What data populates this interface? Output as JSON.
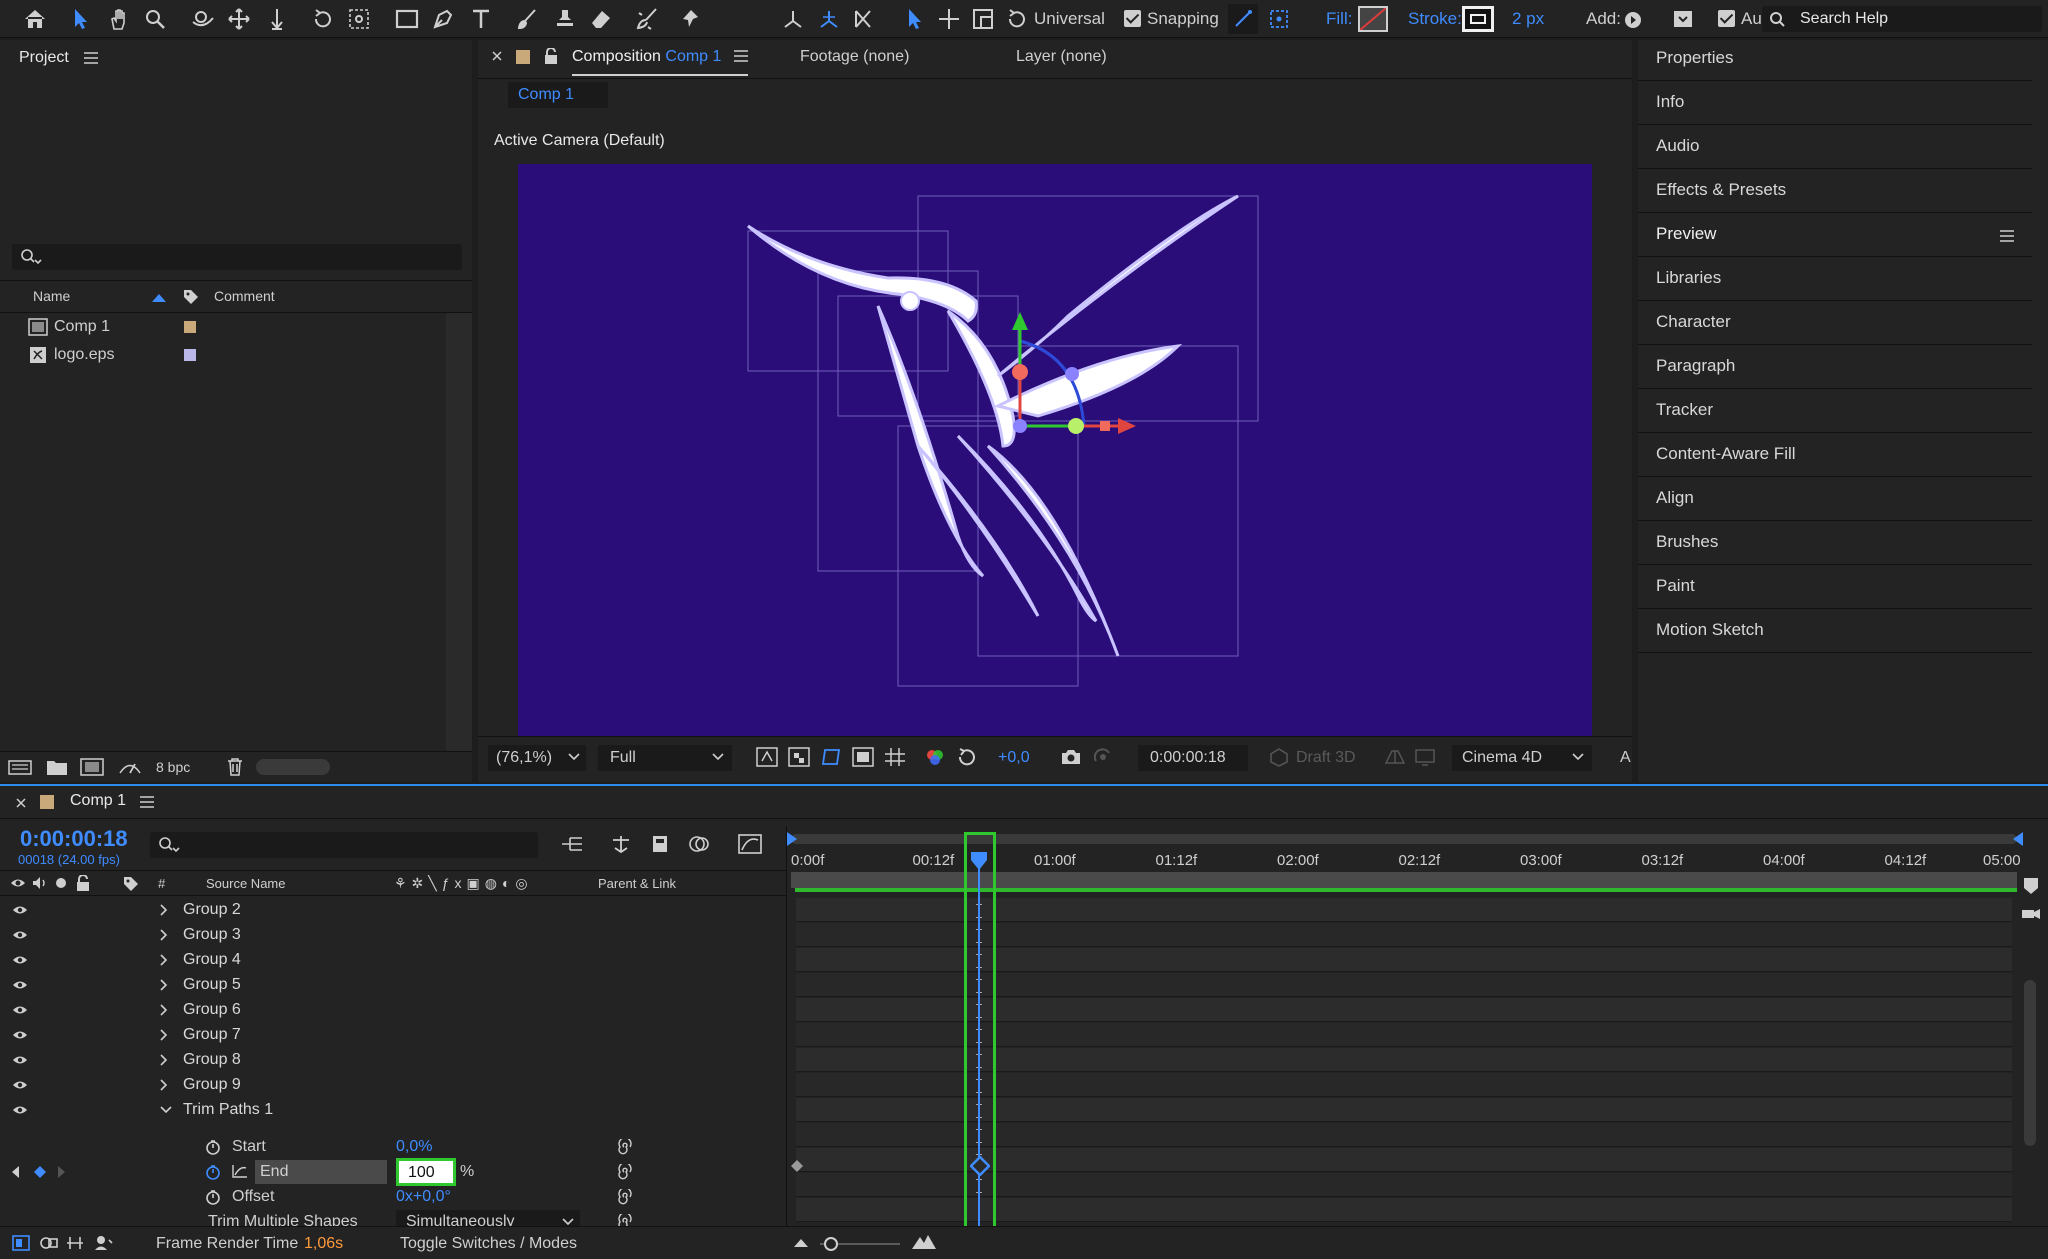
{
  "toolbar": {
    "mode": "Universal",
    "snapping": "Snapping",
    "fill_label": "Fill:",
    "stroke_label": "Stroke:",
    "stroke_width": "2 px",
    "add_label": "Add:",
    "auto_label": "Auto",
    "search_placeholder": "Search Help"
  },
  "project": {
    "title": "Project",
    "col_name": "Name",
    "col_comment": "Comment",
    "items": [
      {
        "name": "Comp 1",
        "color": "#c9a87a"
      },
      {
        "name": "logo.eps",
        "color": "#b9b6e8"
      }
    ],
    "bpc": "8 bpc"
  },
  "comp": {
    "tab_prefix": "Composition",
    "tab_name": "Comp 1",
    "footage": "Footage (none)",
    "layer": "Layer (none)",
    "sub_tab": "Comp 1",
    "camera": "Active Camera (Default)",
    "zoom": "(76,1%)",
    "resolution": "Full",
    "exposure": "+0,0",
    "timecode": "0:00:00:18",
    "draft": "Draft 3D",
    "renderer": "Cinema 4D",
    "extra": "A",
    "bg": "#2a0d78"
  },
  "right_panels": [
    "Properties",
    "Info",
    "Audio",
    "Effects & Presets",
    "Preview",
    "Libraries",
    "Character",
    "Paragraph",
    "Tracker",
    "Content-Aware Fill",
    "Align",
    "Brushes",
    "Paint",
    "Motion Sketch"
  ],
  "timeline": {
    "comp_name": "Comp 1",
    "timecode": "0:00:00:18",
    "frame_info": "00018 (24.00 fps)",
    "col_num": "#",
    "col_source": "Source Name",
    "col_parent": "Parent & Link",
    "groups": [
      "Group 2",
      "Group 3",
      "Group 4",
      "Group 5",
      "Group 6",
      "Group 7",
      "Group 8",
      "Group 9"
    ],
    "trim": "Trim Paths 1",
    "props": {
      "start_label": "Start",
      "start_value": "0,0%",
      "end_label": "End",
      "end_value": "100",
      "end_unit": "%",
      "offset_label": "Offset",
      "offset_value": "0x+0,0°",
      "multi_label": "Trim Multiple Shapes",
      "multi_value": "Simultaneously"
    },
    "ruler": [
      "0:00f",
      "00:12f",
      "01:00f",
      "01:12f",
      "02:00f",
      "02:12f",
      "03:00f",
      "03:12f",
      "04:00f",
      "04:12f",
      "05:00"
    ],
    "render_label": "Frame Render Time",
    "render_value": "1,06s",
    "toggle": "Toggle Switches / Modes"
  }
}
